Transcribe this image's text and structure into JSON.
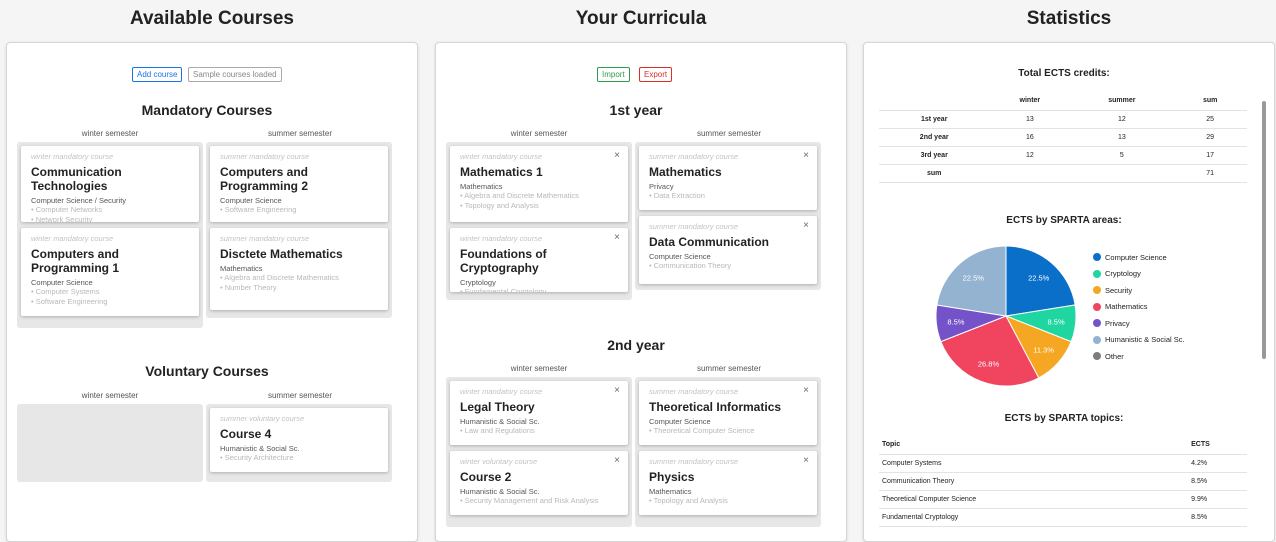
{
  "columns": {
    "available": "Available Courses",
    "curricula": "Your Curricula",
    "statistics": "Statistics"
  },
  "available": {
    "add_course": "Add course",
    "sample_loaded": "Sample courses loaded",
    "mandatory_title": "Mandatory Courses",
    "voluntary_title": "Voluntary Courses",
    "winter_label": "winter semester",
    "summer_label": "summer semester",
    "mandatory_winter": [
      {
        "type": "winter mandatory course",
        "name": "Communication Technologies",
        "area": "Computer Science / Security",
        "topics": [
          "• Computer Networks",
          "• Network Security"
        ]
      },
      {
        "type": "winter mandatory course",
        "name": "Computers and Programming 1",
        "area": "Computer Science",
        "topics": [
          "• Computer Systems",
          "• Software Engineering"
        ]
      }
    ],
    "mandatory_summer": [
      {
        "type": "summer mandatory course",
        "name": "Computers and Programming 2",
        "area": "Computer Science",
        "topics": [
          "• Software Engineering"
        ]
      },
      {
        "type": "summer mandatory course",
        "name": "Disctete Mathematics",
        "area": "Mathematics",
        "topics": [
          "• Algebra and Discrete Mathematics",
          "• Number Theory"
        ]
      }
    ],
    "voluntary_summer": [
      {
        "type": "summer voluntary course",
        "name": "Course 4",
        "area": "Humanistic & Social Sc.",
        "topics": [
          "• Security Architecture"
        ]
      }
    ]
  },
  "curricula": {
    "import": "Import",
    "export": "Export",
    "close_glyph": "×",
    "winter_label": "winter semester",
    "summer_label": "summer semester",
    "years": [
      {
        "title": "1st year",
        "winter": [
          {
            "type": "winter mandatory course",
            "name": "Mathematics 1",
            "area": "Mathematics",
            "topics": [
              "• Algebra and Discrete Mathematics",
              "• Topology and Analysis"
            ]
          },
          {
            "type": "winter mandatory course",
            "name": "Foundations of Cryptography",
            "area": "Cryptology",
            "topics": [
              "• Fundamental Cryptology"
            ]
          }
        ],
        "summer": [
          {
            "type": "summer mandatory course",
            "name": "Mathematics",
            "area": "Privacy",
            "topics": [
              "• Data Extraction"
            ]
          },
          {
            "type": "summer mandatory course",
            "name": "Data Communication",
            "area": "Computer Science",
            "topics": [
              "• Communication Theory"
            ]
          }
        ]
      },
      {
        "title": "2nd year",
        "winter": [
          {
            "type": "winter mandatory course",
            "name": "Legal Theory",
            "area": "Humanistic & Social Sc.",
            "topics": [
              "• Law and Regulations"
            ]
          },
          {
            "type": "winter voluntary course",
            "name": "Course 2",
            "area": "Humanistic & Social Sc.",
            "topics": [
              "• Security Management and Risk Analysis"
            ]
          }
        ],
        "summer": [
          {
            "type": "summer mandatory course",
            "name": "Theoretical Informatics",
            "area": "Computer Science",
            "topics": [
              "• Theoretical Computer Science"
            ]
          },
          {
            "type": "summer mandatory course",
            "name": "Physics",
            "area": "Mathematics",
            "topics": [
              "• Topology and Analysis"
            ]
          }
        ]
      }
    ]
  },
  "statistics": {
    "ects_title": "Total ECTS credits:",
    "ects_table": {
      "headers": [
        "",
        "winter",
        "summer",
        "sum"
      ],
      "rows": [
        [
          "1st year",
          "13",
          "12",
          "25"
        ],
        [
          "2nd year",
          "16",
          "13",
          "29"
        ],
        [
          "3rd year",
          "12",
          "5",
          "17"
        ],
        [
          "sum",
          "",
          "",
          "71"
        ]
      ]
    },
    "areas_title": "ECTS by SPARTA areas:",
    "topics_title": "ECTS by SPARTA topics:",
    "topics_table": {
      "headers": [
        "Topic",
        "ECTS"
      ],
      "rows": [
        [
          "Computer Systems",
          "4.2%"
        ],
        [
          "Communication Theory",
          "8.5%"
        ],
        [
          "Theoretical Computer Science",
          "9.9%"
        ],
        [
          "Fundamental Cryptology",
          "8.5%"
        ]
      ]
    }
  },
  "chart_data": {
    "type": "pie",
    "title": "ECTS by SPARTA areas:",
    "legend_position": "right",
    "slices": [
      {
        "name": "Computer Science",
        "value": 22.5,
        "label": "22.5%",
        "color": "#0a6fc8"
      },
      {
        "name": "Cryptology",
        "value": 8.5,
        "label": "8.5%",
        "color": "#1fd6a0"
      },
      {
        "name": "Security",
        "value": 11.3,
        "label": "11.3%",
        "color": "#f5a623"
      },
      {
        "name": "Mathematics",
        "value": 26.8,
        "label": "26.8%",
        "color": "#f0445f"
      },
      {
        "name": "Privacy",
        "value": 8.5,
        "label": "8.5%",
        "color": "#7452c8"
      },
      {
        "name": "Humanistic & Social Sc.",
        "value": 22.5,
        "label": "22.5%",
        "color": "#94b3d0"
      },
      {
        "name": "Other",
        "value": 0,
        "label": "",
        "color": "#7d7d7d"
      }
    ]
  }
}
